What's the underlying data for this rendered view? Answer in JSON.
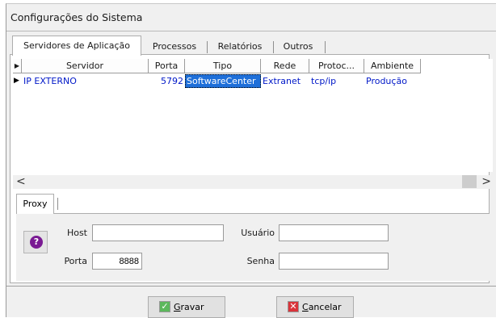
{
  "window": {
    "title": "Configurações do Sistema"
  },
  "tabs": [
    {
      "label": "Servidores de Aplicação",
      "active": true
    },
    {
      "label": "Processos",
      "active": false
    },
    {
      "label": "Relatórios",
      "active": false
    },
    {
      "label": "Outros",
      "active": false
    }
  ],
  "grid": {
    "columns": [
      "Servidor",
      "Porta",
      "Tipo",
      "Rede",
      "Protoc...",
      "Ambiente"
    ],
    "rows": [
      {
        "servidor": "IP EXTERNO",
        "porta": "5792",
        "tipo": "SoftwareCenter",
        "rede": "Extranet",
        "protocolo": "tcp/ip",
        "ambiente": "Produção",
        "selected_cell": "tipo"
      }
    ],
    "row_indicator": "▶",
    "header_indicator": "▼"
  },
  "scrollbar": {
    "left_arrow": "<",
    "right_arrow": ">"
  },
  "proxy": {
    "tab_label": "Proxy",
    "host_label": "Host",
    "host_value": "",
    "porta_label": "Porta",
    "porta_value": "8888",
    "usuario_label": "Usuário",
    "usuario_value": "",
    "senha_label": "Senha",
    "senha_value": "",
    "help_symbol": "?"
  },
  "buttons": {
    "gravar": {
      "mnemonic": "G",
      "rest": "ravar",
      "icon": "check-icon",
      "icon_glyph": "✓",
      "color": "#5cb85c"
    },
    "cancelar": {
      "mnemonic": "C",
      "rest": "ancelar",
      "icon": "close-icon",
      "icon_glyph": "✕",
      "color": "#d9343a"
    }
  }
}
